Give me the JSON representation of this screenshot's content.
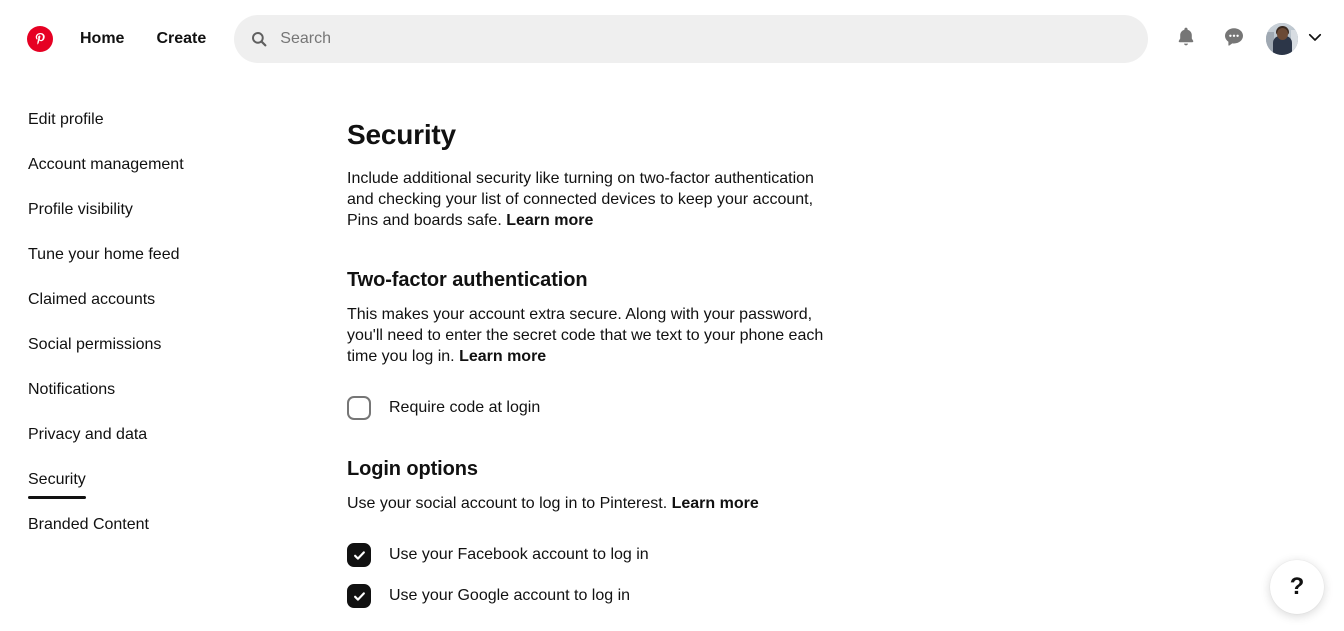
{
  "header": {
    "logo_alt": "Pinterest",
    "nav": [
      {
        "label": "Home"
      },
      {
        "label": "Create"
      }
    ],
    "search": {
      "placeholder": "Search",
      "value": ""
    },
    "icons": {
      "notifications": "bell-icon",
      "messages": "speech-bubble-icon",
      "account_chevron": "chevron-down-icon"
    }
  },
  "sidebar": {
    "items": [
      {
        "label": "Edit profile",
        "active": false
      },
      {
        "label": "Account management",
        "active": false
      },
      {
        "label": "Profile visibility",
        "active": false
      },
      {
        "label": "Tune your home feed",
        "active": false
      },
      {
        "label": "Claimed accounts",
        "active": false
      },
      {
        "label": "Social permissions",
        "active": false
      },
      {
        "label": "Notifications",
        "active": false
      },
      {
        "label": "Privacy and data",
        "active": false
      },
      {
        "label": "Security",
        "active": true
      },
      {
        "label": "Branded Content",
        "active": false
      }
    ]
  },
  "main": {
    "title": "Security",
    "intro_text": "Include additional security like turning on two-factor authentication and checking your list of connected devices to keep your account, Pins and boards safe. ",
    "intro_link": "Learn more",
    "two_factor": {
      "heading": "Two-factor authentication",
      "description": "This makes your account extra secure. Along with your password, you'll need to enter the secret code that we text to your phone each time you log in. ",
      "link": "Learn more",
      "checkbox": {
        "label": "Require code at login",
        "checked": false
      }
    },
    "login_options": {
      "heading": "Login options",
      "description": "Use your social account to log in to Pinterest. ",
      "link": "Learn more",
      "checkboxes": [
        {
          "label": "Use your Facebook account to log in",
          "checked": true
        },
        {
          "label": "Use your Google account to log in",
          "checked": true
        }
      ]
    }
  },
  "help": {
    "label": "?"
  },
  "colors": {
    "brand_red": "#e60023",
    "text": "#111111",
    "muted": "#767676",
    "search_bg": "#efefef"
  }
}
